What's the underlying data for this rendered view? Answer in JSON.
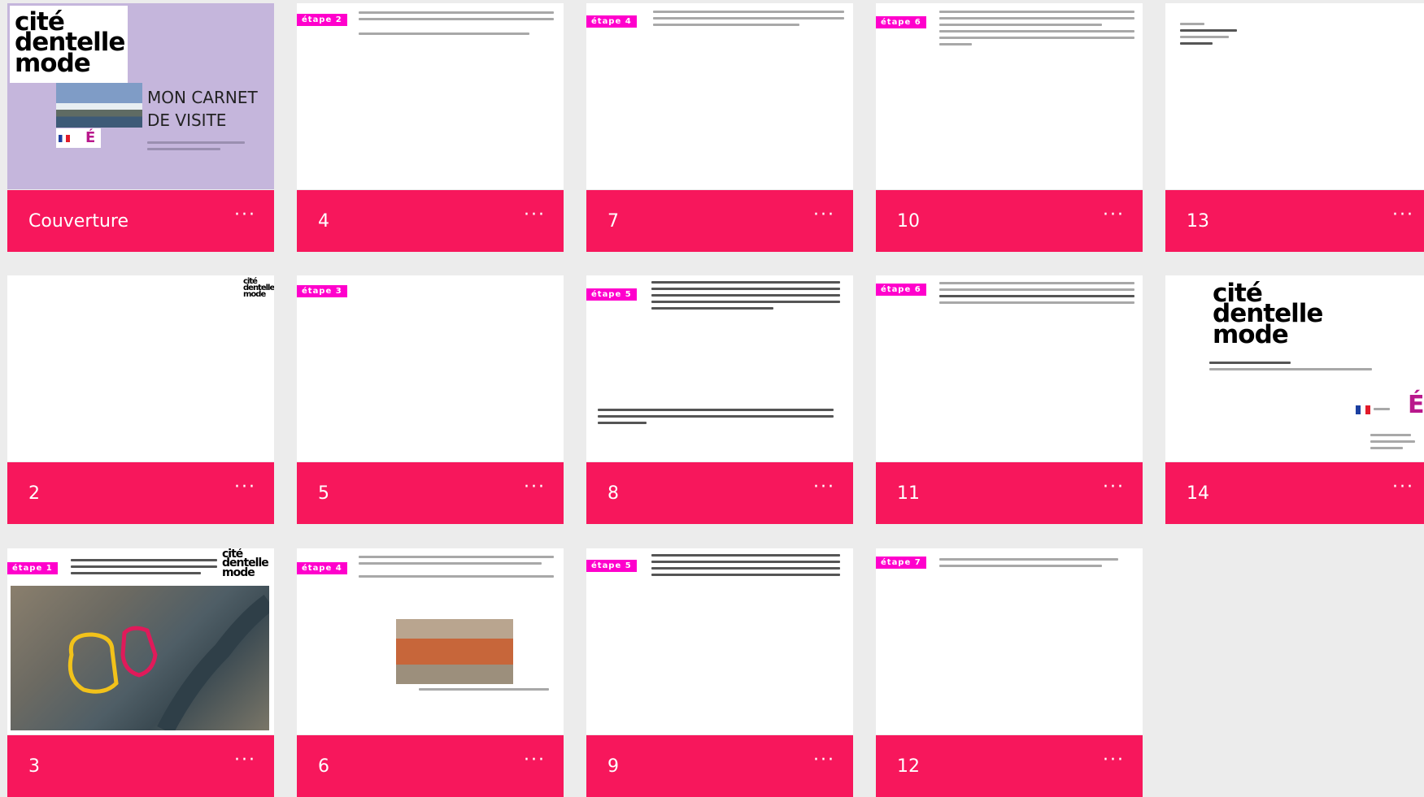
{
  "slides": [
    {
      "label": "Couverture",
      "more": "···"
    },
    {
      "label": "2",
      "more": "···"
    },
    {
      "label": "3",
      "more": "···"
    },
    {
      "label": "4",
      "more": "···"
    },
    {
      "label": "5",
      "more": "···"
    },
    {
      "label": "6",
      "more": "···"
    },
    {
      "label": "7",
      "more": "···"
    },
    {
      "label": "8",
      "more": "···"
    },
    {
      "label": "9",
      "more": "···"
    },
    {
      "label": "10",
      "more": "···"
    },
    {
      "label": "11",
      "more": "···"
    },
    {
      "label": "12",
      "more": "···"
    },
    {
      "label": "13",
      "more": "···"
    },
    {
      "label": "14",
      "more": "···"
    }
  ],
  "cover": {
    "logo_lines": [
      "cité",
      "dentelle",
      "mode"
    ],
    "title_line1": "MON CARNET",
    "title_line2": "DE VISITE"
  },
  "logo_lines": [
    "cité",
    "dentelle",
    "mode"
  ],
  "etape_labels": {
    "s3": "étape 1",
    "s4": "étape 2",
    "s5": "étape 3",
    "s6": "étape 4",
    "s7": "étape 4",
    "s8": "étape 5",
    "s9": "étape 5",
    "s10": "étape 6",
    "s11": "étape 6",
    "s12": "étape 7"
  },
  "colors": {
    "accent": "#f7175c",
    "etape": "#ff00cc",
    "cover_bg": "#c5b6dc",
    "page_bg": "#ececec"
  }
}
